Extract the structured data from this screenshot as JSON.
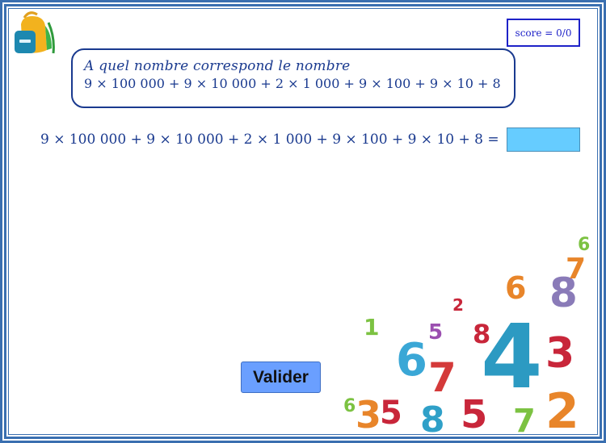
{
  "score": {
    "label": "score = 0/0"
  },
  "question": {
    "title": "A quel nombre correspond le nombre",
    "expression": "9 × 100 000 + 9 × 10 000 + 2 × 1 000 + 9 × 100 + 9 × 10 + 8"
  },
  "equation": {
    "text": "9 × 100 000 + 9 × 10 000 + 2 × 1 000 + 9 × 100 + 9 × 10 + 8 ="
  },
  "answer": {
    "value": ""
  },
  "validate": {
    "label": "Valider"
  },
  "icons": {
    "logo": "backpack-icon",
    "decoration": "colorful-numbers-illustration"
  },
  "colors": {
    "frame": "#3a6fb0",
    "text": "#1a3a8f",
    "answer_field": "#66ccff",
    "button": "#6a9fff",
    "score_border": "#1e22c8"
  }
}
